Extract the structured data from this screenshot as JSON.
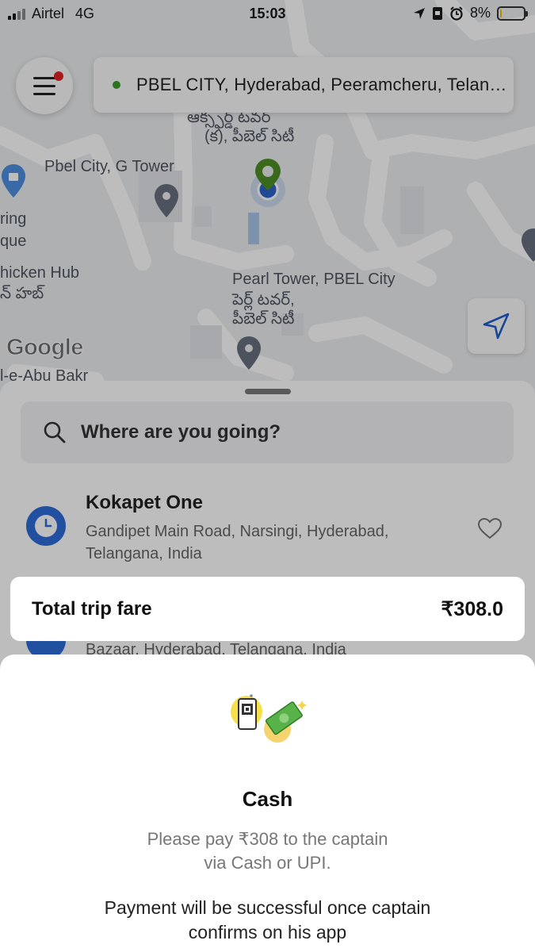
{
  "status_bar": {
    "carrier": "Airtel",
    "network": "4G",
    "time": "15:03",
    "battery": "8%",
    "battery_level": 0.08
  },
  "map": {
    "pickup_address": "PBEL CITY, Hyderabad, Peeramcheru, Telangana, India",
    "labels": {
      "telugu_top": "ఆక్స్ఫర్డ్ టవర్",
      "telugu_top2": "(క), పీబెల్ సిటీ",
      "pbel_tower": "Pbel City, G Tower",
      "ring": "ring",
      "que": "que",
      "chicken_hub": "hicken Hub",
      "chicken_hub_te": "న్ హబ్",
      "pearl_tower": "Pearl Tower, PBEL City",
      "pearl_tower_te1": "పెర్ల్ టవర్,",
      "pearl_tower_te2": "పీబెల్ సిటీ",
      "abu_bakr": "l-e-Abu Bakr",
      "google": "Google"
    }
  },
  "sheet": {
    "search_placeholder": "Where are you going?",
    "recent": {
      "title": "Kokapet One",
      "subtitle": "Gandipet Main Road, Narsingi, Hyderabad, Telangana, India"
    },
    "recent2_subtitle": "Bazaar, Hyderabad, Telangana, India"
  },
  "fare": {
    "label": "Total trip fare",
    "amount": "₹308.0"
  },
  "payment": {
    "title": "Cash",
    "desc_line1": "Please pay ₹308 to the captain",
    "desc_line2": "via Cash or UPI.",
    "note_line1": "Payment will be successful once captain",
    "note_line2": "confirms on his app"
  },
  "icons": {
    "menu": "hamburger-icon",
    "notification": "notification-dot-icon",
    "search": "search-icon",
    "locate": "navigation-arrow-icon",
    "recent": "clock-icon",
    "favorite": "heart-icon",
    "payment": "cash-upi-icon"
  },
  "colors": {
    "pickup_dot": "#3a9b2a",
    "clock_blue": "#2f6dd8",
    "notification_red": "#e02424"
  }
}
